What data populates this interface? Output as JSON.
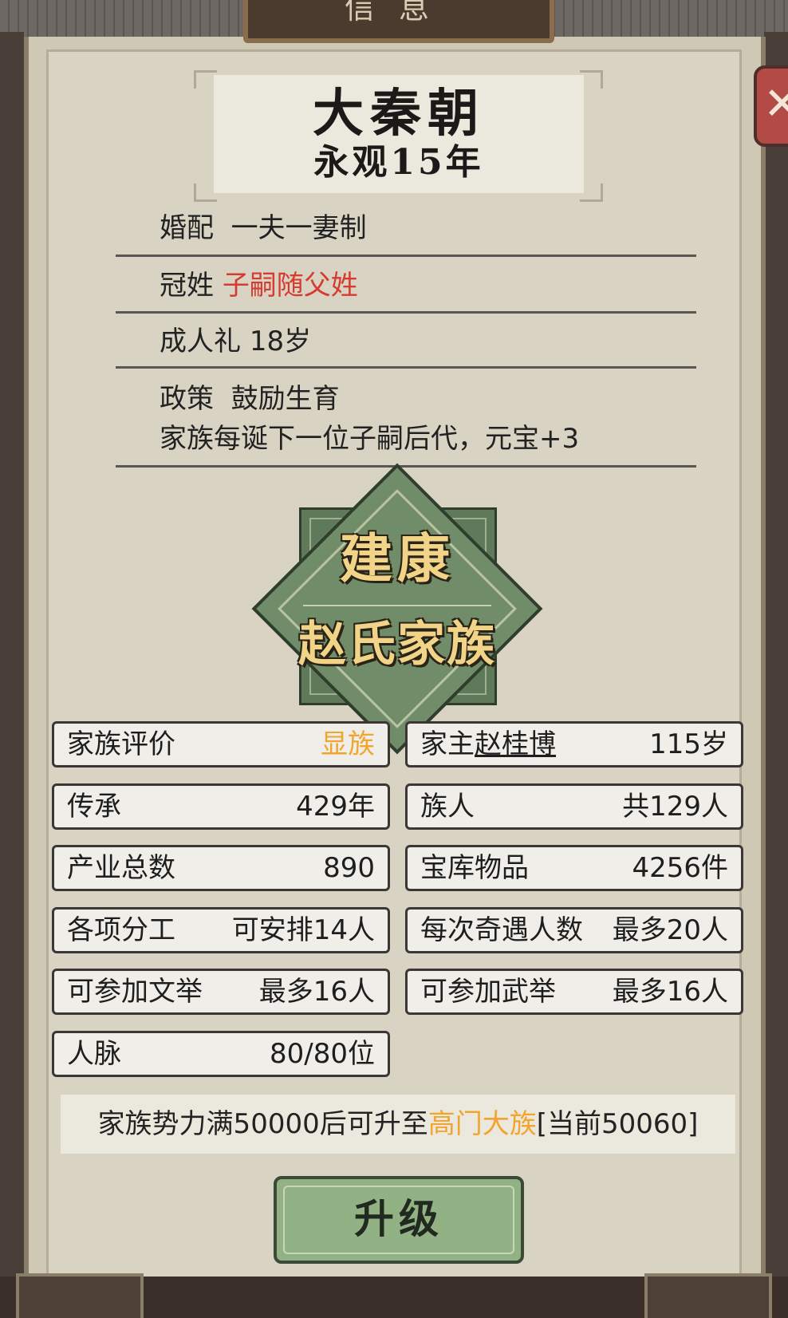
{
  "title": "信息",
  "close_icon": "close-x-icon",
  "header": {
    "dynasty": "大秦朝",
    "era": "永观15年"
  },
  "policies": {
    "marriage_label": "婚配",
    "marriage_value": "一夫一妻制",
    "surname_label": "冠姓",
    "surname_value": "子嗣随父姓",
    "coming_of_age_label": "成人礼",
    "coming_of_age_value": "18岁",
    "policy_label": "政策",
    "policy_value": "鼓励生育",
    "policy_desc": "家族每诞下一位子嗣后代，元宝+3"
  },
  "emblem": {
    "city": "建康",
    "family": "赵氏家族"
  },
  "stats": {
    "rating_label": "家族评价",
    "rating_value": "显族",
    "head_label": "家主",
    "head_name": "赵桂博",
    "head_age": "115岁",
    "heritage_label": "传承",
    "heritage_value": "429年",
    "members_label": "族人",
    "members_value": "共129人",
    "industry_label": "产业总数",
    "industry_value": "890",
    "treasury_label": "宝库物品",
    "treasury_value": "4256件",
    "work_label": "各项分工",
    "work_value": "可安排14人",
    "encounter_label": "每次奇遇人数",
    "encounter_value": "最多20人",
    "civil_exam_label": "可参加文举",
    "civil_exam_value": "最多16人",
    "military_exam_label": "可参加武举",
    "military_exam_value": "最多16人",
    "network_label": "人脉",
    "network_value": "80/80位"
  },
  "upgrade": {
    "text_prefix": "家族势力满50000后可升至",
    "target": "高门大族",
    "text_suffix": "[当前50060]",
    "button": "升级"
  },
  "colors": {
    "accent_orange": "#f2a52e",
    "accent_red": "#d63b30",
    "emblem_green": "#718c68",
    "button_green": "#92b285"
  }
}
